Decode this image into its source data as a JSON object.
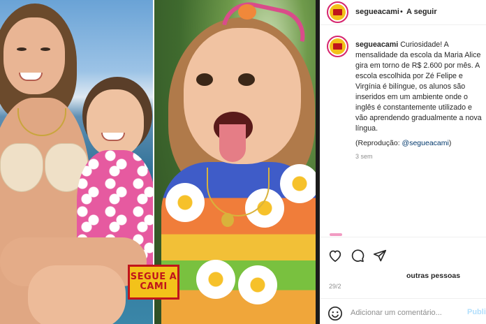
{
  "photos": {
    "sticker_line1": "SEGUE A",
    "sticker_line2": "CAMI"
  },
  "post": {
    "header": {
      "username": "segueacami",
      "separator": "•",
      "follow_label": "A seguir"
    },
    "caption": {
      "username": "segueacami",
      "text": "Curiosidade! A mensalidade da escola da Maria Alice gira em torno de R$ 2.600 por mês. A escola escolhida por Zé Felipe e Virgínia é bilíngue, os alunos são inseridos em um ambiente onde o inglês é constantemente utilizado e vão aprendendo gradualmente a nova língua.",
      "credit_prefix": "(Reprodução: ",
      "credit_handle": "@segueacami",
      "credit_suffix": ")",
      "time_ago": "3 sem"
    },
    "actions": {
      "like_icon": "heart-icon",
      "comment_icon": "comment-bubble-icon",
      "share_icon": "paper-plane-icon"
    },
    "likes_text_bold": "outras pessoas",
    "date": "29/2",
    "comment": {
      "emoji_icon": "smiley-icon",
      "placeholder": "Adicionar um comentário...",
      "publish_label": "Publicar"
    },
    "colors": {
      "avatar_ring": "#d6266e",
      "link": "#00376b",
      "publish_disabled": "#b2dffc",
      "secondary_text": "#8e8e8e"
    }
  }
}
